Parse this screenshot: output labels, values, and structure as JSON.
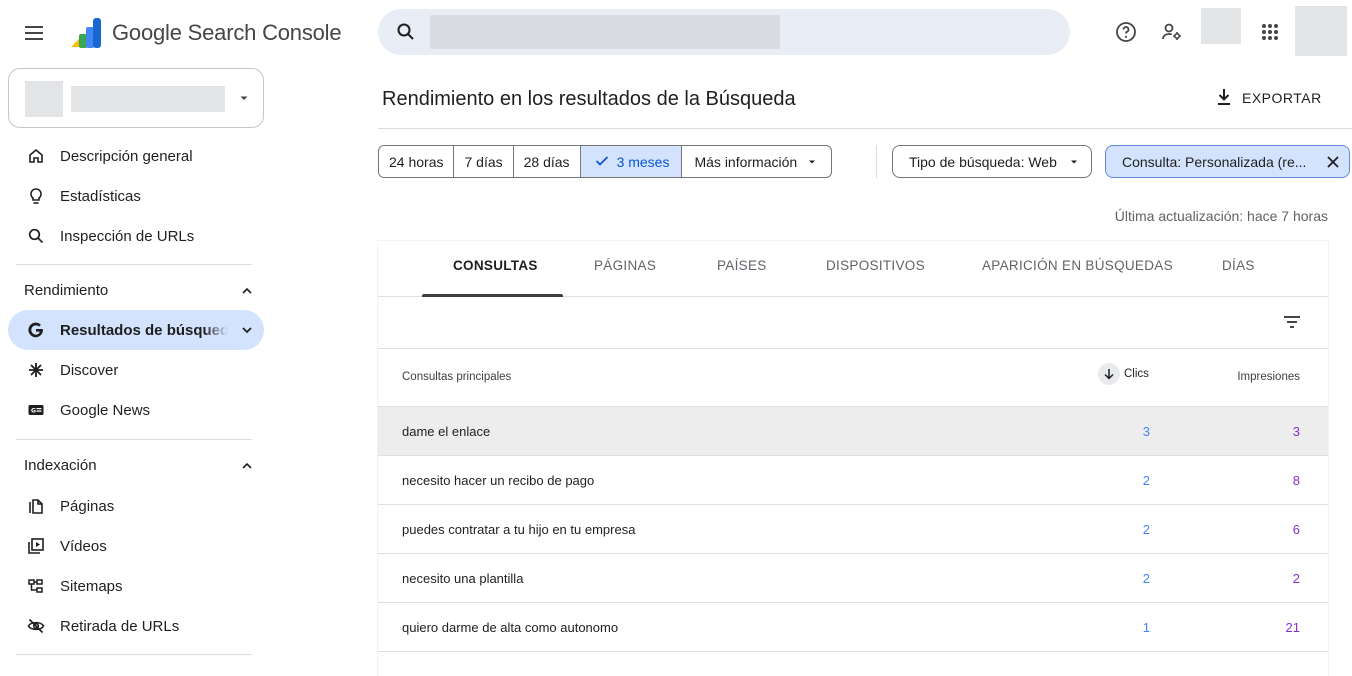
{
  "app": {
    "brand": "Google Search Console"
  },
  "search": {
    "placeholder": ""
  },
  "sidebar": {
    "top_items": [
      {
        "label": "Descripción general",
        "icon": "home-icon"
      },
      {
        "label": "Estadísticas",
        "icon": "lightbulb-icon"
      },
      {
        "label": "Inspección de URLs",
        "icon": "search-icon"
      }
    ],
    "rendimiento": {
      "title": "Rendimiento",
      "items": [
        {
          "label": "Resultados de búsqueda",
          "icon": "google-g-icon",
          "active": true
        },
        {
          "label": "Discover",
          "icon": "asterisk-icon"
        },
        {
          "label": "Google News",
          "icon": "news-icon"
        }
      ]
    },
    "indexacion": {
      "title": "Indexación",
      "items": [
        {
          "label": "Páginas",
          "icon": "pages-icon"
        },
        {
          "label": "Vídeos",
          "icon": "video-icon"
        },
        {
          "label": "Sitemaps",
          "icon": "sitemap-icon"
        },
        {
          "label": "Retirada de URLs",
          "icon": "eye-off-icon"
        }
      ]
    }
  },
  "main": {
    "title": "Rendimiento en los resultados de la Búsqueda",
    "export_label": "EXPORTAR",
    "ranges": [
      {
        "label": "24 horas",
        "selected": false
      },
      {
        "label": "7 días",
        "selected": false
      },
      {
        "label": "28 días",
        "selected": false
      },
      {
        "label": "3 meses",
        "selected": true
      },
      {
        "label": "Más información",
        "selected": false
      }
    ],
    "type_chip": "Tipo de búsqueda: Web",
    "filter_chip": "Consulta: Personalizada (re...",
    "updated": "Última actualización: hace 7 horas",
    "tabs": [
      "CONSULTAS",
      "PÁGINAS",
      "PAÍSES",
      "DISPOSITIVOS",
      "APARICIÓN EN BÚSQUEDAS",
      "DÍAS"
    ],
    "table": {
      "col_query": "Consultas principales",
      "col_clicks": "Clics",
      "col_impressions": "Impresiones",
      "rows": [
        {
          "query": "dame el enlace",
          "clicks": "3",
          "impressions": "3"
        },
        {
          "query": "necesito hacer un recibo de pago",
          "clicks": "2",
          "impressions": "8"
        },
        {
          "query": "puedes contratar a tu hijo en tu empresa",
          "clicks": "2",
          "impressions": "6"
        },
        {
          "query": "necesito una plantilla",
          "clicks": "2",
          "impressions": "2"
        },
        {
          "query": "quiero darme de alta como autonomo",
          "clicks": "1",
          "impressions": "21"
        }
      ]
    }
  },
  "colors": {
    "accent": "#0b57d0",
    "active_bg": "#d3e3fd",
    "clicks": "#4285f4",
    "impressions": "#8430ce"
  }
}
